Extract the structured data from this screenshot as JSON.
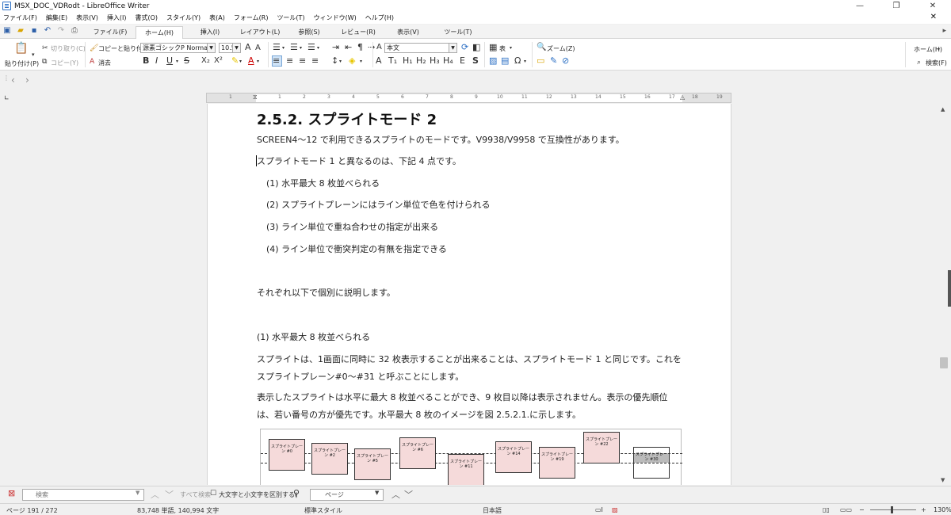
{
  "window": {
    "title": "MSX_DOC_VDRodt - LibreOffice Writer",
    "minimize": "—",
    "restore": "❐",
    "close": "✕"
  },
  "menu": [
    "ファイル(F)",
    "編集(E)",
    "表示(V)",
    "挿入(I)",
    "書式(O)",
    "スタイル(Y)",
    "表(A)",
    "フォーム(R)",
    "ツール(T)",
    "ウィンドウ(W)",
    "ヘルプ(H)"
  ],
  "menu_close": "✕",
  "tabs": [
    {
      "label": "ファイル(F)",
      "active": false
    },
    {
      "label": "ホーム(H)",
      "active": true
    },
    {
      "label": "挿入(I)",
      "active": false
    },
    {
      "label": "レイアウト(L)",
      "active": false
    },
    {
      "label": "参照(S)",
      "active": false
    },
    {
      "label": "レビュー(R)",
      "active": false
    },
    {
      "label": "表示(V)",
      "active": false
    },
    {
      "label": "ツール(T)",
      "active": false
    }
  ],
  "ribbon": {
    "paste": "貼り付け(P)",
    "cut": "切り取り(C)",
    "copy": "コピー(Y)",
    "clone": "コピーと貼り付け",
    "clear": "消去",
    "font_name": "源素ゴシックP Normal",
    "font_size": "10.5",
    "paragraph_style": "本文",
    "table": "表",
    "zoom": "ズーム(Z)",
    "home_right": "ホーム(H)",
    "find_right": "検索(F)"
  },
  "document": {
    "heading": "2.5.2. スプライトモード 2",
    "paragraphs": [
      "SCREEN4〜12 で利用できるスプライトのモードです。V9938/V9958 で互換性があります。",
      "スプライトモード 1 と異なるのは、下記 4 点です。"
    ],
    "list": [
      "(1) 水平最大 8 枚並べられる",
      "(2) スプライトプレーンにはライン単位で色を付けられる",
      "(3) ライン単位で重ね合わせの指定が出来る",
      "(4) ライン単位で衝突判定の有無を指定できる"
    ],
    "explain": "それぞれ以下で個別に説明します。",
    "subheading": "(1) 水平最大 8 枚並べられる",
    "body1": "スプライトは、1画面に同時に 32 枚表示することが出来ることは、スプライトモード 1 と同じです。これをスプライトプレーン#0〜#31 と呼ぶことにします。",
    "body2": "表示したスプライトは水平に最大 8 枚並べることができ、9 枚目以降は表示されません。表示の優先順位は、若い番号の方が優先です。水平最大 8 枚のイメージを図 2.5.2.1.に示します。"
  },
  "figure": {
    "sprites": [
      {
        "label": "スプライトプレーン #0"
      },
      {
        "label": "スプライトプレーン #2"
      },
      {
        "label": "スプライトプレーン #5"
      },
      {
        "label": "スプライトプレーン #6"
      },
      {
        "label": "スプライトプレーン #11"
      },
      {
        "label": "スプライトプレーン #14"
      },
      {
        "label": "スプライトプレーン #19"
      },
      {
        "label": "スプライトプレーン #22"
      },
      {
        "label": "スプライトプレーン #30"
      }
    ]
  },
  "ruler_numbers": [
    "1",
    "1",
    "2",
    "3",
    "4",
    "5",
    "6",
    "7",
    "8",
    "9",
    "10",
    "11",
    "12",
    "13",
    "14",
    "15",
    "16",
    "17",
    "18",
    "19"
  ],
  "findbar": {
    "placeholder": "検索",
    "find_all": "すべて検索",
    "match_case": "大文字と小文字を区別する(",
    "page": "ページ"
  },
  "status": {
    "page": "ページ 191 / 272",
    "words": "83,748 単語, 140,994 文字",
    "style": "標準スタイル",
    "language": "日本語",
    "zoom": "130%"
  }
}
